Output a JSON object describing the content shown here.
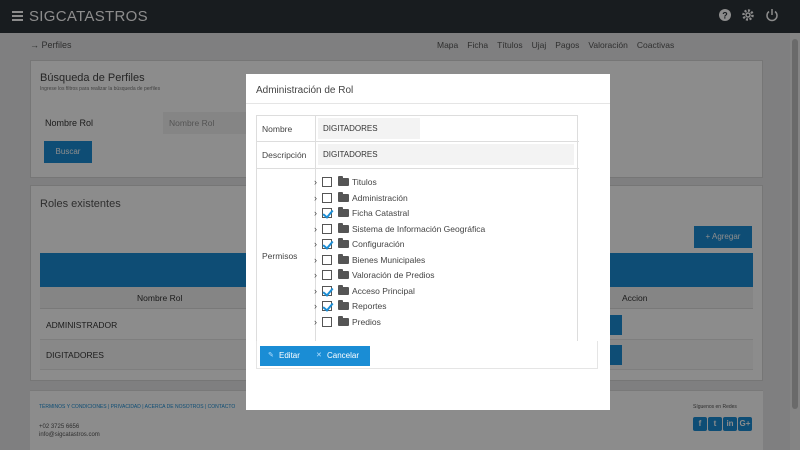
{
  "topbar": {
    "brand": "SIGCATASTROS",
    "icons": [
      "menu-icon",
      "help-icon",
      "gear-icon",
      "power-icon"
    ]
  },
  "breadcrumb": "→ Perfiles",
  "nav_links": [
    "Mapa",
    "Ficha",
    "Títulos",
    "Ujaj",
    "Pagos",
    "Valoración",
    "Coactivas"
  ],
  "search_card": {
    "title": "Búsqueda de Perfiles",
    "subtitle": "Ingrese los filtros para realizar la búsqueda de perfiles",
    "field_label": "Nombre Rol",
    "field_placeholder": "Nombre Rol",
    "search_button": "Buscar"
  },
  "roles_card": {
    "title": "Roles existentes",
    "add_button": "Agregar",
    "columns": [
      "Nombre Rol",
      "Accion"
    ],
    "rows": [
      "ADMINISTRADOR",
      "DIGITADORES"
    ]
  },
  "footer": {
    "links": "TÉRMINOS Y CONDICIONES | PRIVACIDAD | ACERCA DE NOSOTROS | CONTACTO",
    "phone": "+02 3725 6656",
    "email": "info@sigcatastros.com",
    "social_label": "Síguenos en Redes"
  },
  "modal": {
    "title": "Administración de Rol",
    "name_label": "Nombre",
    "name_value": "DIGITADORES",
    "description_label": "Descripción",
    "description_value": "DIGITADORES",
    "permissions_label": "Permisos",
    "permissions": [
      {
        "label": "Titulos",
        "checked": false
      },
      {
        "label": "Administración",
        "checked": false
      },
      {
        "label": "Ficha Catastral",
        "checked": true
      },
      {
        "label": "Sistema de Información Geográfica",
        "checked": false
      },
      {
        "label": "Configuración",
        "checked": true
      },
      {
        "label": "Bienes Municipales",
        "checked": false
      },
      {
        "label": "Valoración de Predios",
        "checked": false
      },
      {
        "label": "Acceso Principal",
        "checked": true
      },
      {
        "label": "Reportes",
        "checked": true
      },
      {
        "label": "Predios",
        "checked": false
      }
    ],
    "edit_button": "Editar",
    "cancel_button": "Cancelar"
  },
  "colors": {
    "accent": "#1a8dd5",
    "topbar": "#2d3339"
  }
}
